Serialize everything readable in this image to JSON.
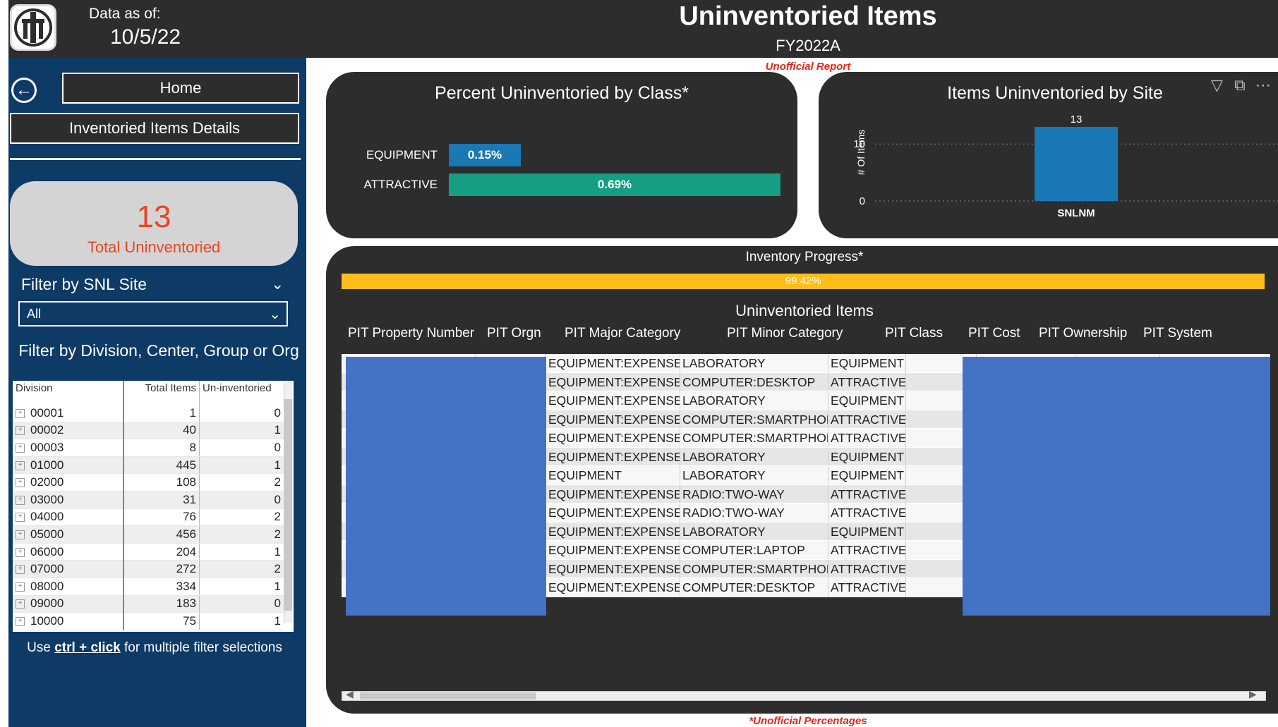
{
  "header": {
    "as_of_label": "Data as of:",
    "as_of_date": "10/5/22",
    "title": "Uninventoried Items",
    "subtitle": "FY2022A",
    "unofficial_report": "Unofficial Report"
  },
  "sidebar": {
    "back_icon": "back-arrow-icon",
    "home_label": "Home",
    "details_label": "Inventoried Items Details",
    "kpi_value": "13",
    "kpi_label": "Total Uninventoried",
    "site_filter_label": "Filter by SNL Site",
    "site_filter_value": "All",
    "division_filter_label": "Filter by Division, Center, Group or Org",
    "division_table": {
      "headers": [
        "Division",
        "Total Items",
        "Un-inventoried"
      ],
      "rows": [
        {
          "division": "00001",
          "total": "1",
          "uninv": "0"
        },
        {
          "division": "00002",
          "total": "40",
          "uninv": "1"
        },
        {
          "division": "00003",
          "total": "8",
          "uninv": "0"
        },
        {
          "division": "01000",
          "total": "445",
          "uninv": "1"
        },
        {
          "division": "02000",
          "total": "108",
          "uninv": "2"
        },
        {
          "division": "03000",
          "total": "31",
          "uninv": "0"
        },
        {
          "division": "04000",
          "total": "76",
          "uninv": "2"
        },
        {
          "division": "05000",
          "total": "456",
          "uninv": "2"
        },
        {
          "division": "06000",
          "total": "204",
          "uninv": "1"
        },
        {
          "division": "07000",
          "total": "272",
          "uninv": "2"
        },
        {
          "division": "08000",
          "total": "334",
          "uninv": "1"
        },
        {
          "division": "09000",
          "total": "183",
          "uninv": "0"
        },
        {
          "division": "10000",
          "total": "75",
          "uninv": "1"
        }
      ]
    },
    "hint_prefix": "Use ",
    "hint_key": "ctrl + click",
    "hint_suffix": " for multiple filter selections"
  },
  "class_card": {
    "title": "Percent Uninventoried by Class*",
    "bars": [
      {
        "label": "EQUIPMENT",
        "value_label": "0.15%",
        "value": 0.15,
        "color": "#1a78b4"
      },
      {
        "label": "ATTRACTIVE",
        "value_label": "0.69%",
        "value": 0.69,
        "color": "#159e82"
      }
    ],
    "max_value": 0.69
  },
  "site_card": {
    "title": "Items Uninventoried by Site",
    "icons": [
      "filter-icon",
      "focus-mode-icon",
      "more-options-icon"
    ],
    "chart_data": {
      "type": "bar",
      "categories": [
        "SNLNM"
      ],
      "values": [
        13
      ],
      "ylabel": "# Of Items",
      "yticks": [
        "0",
        "10"
      ],
      "ylim": [
        0,
        13
      ],
      "grid": true,
      "color": "#1a78b4"
    }
  },
  "progress": {
    "title": "Inventory Progress*",
    "value_label": "99.42%",
    "value": 99.42,
    "color": "#ffbe1a"
  },
  "items_table": {
    "title": "Uninventoried Items",
    "headers": [
      "PIT Property Number",
      "PIT Orgn",
      "PIT Major Category",
      "PIT Minor Category",
      "PIT Class",
      "PIT Cost",
      "PIT Ownership",
      "PIT System"
    ],
    "rows": [
      {
        "major": "EQUIPMENT:EXPENSED",
        "minor": "LABORATORY",
        "class": "EQUIPMENT"
      },
      {
        "major": "EQUIPMENT:EXPENSED",
        "minor": "COMPUTER:DESKTOP",
        "class": "ATTRACTIVE"
      },
      {
        "major": "EQUIPMENT:EXPENSED",
        "minor": "LABORATORY",
        "class": "EQUIPMENT"
      },
      {
        "major": "EQUIPMENT:EXPENSED",
        "minor": "COMPUTER:SMARTPHONE",
        "class": "ATTRACTIVE"
      },
      {
        "major": "EQUIPMENT:EXPENSED",
        "minor": "COMPUTER:SMARTPHONE",
        "class": "ATTRACTIVE"
      },
      {
        "major": "EQUIPMENT:EXPENSED",
        "minor": "LABORATORY",
        "class": "EQUIPMENT"
      },
      {
        "major": "EQUIPMENT",
        "minor": "LABORATORY",
        "class": "EQUIPMENT"
      },
      {
        "major": "EQUIPMENT:EXPENSED",
        "minor": "RADIO:TWO-WAY",
        "class": "ATTRACTIVE"
      },
      {
        "major": "EQUIPMENT:EXPENSED",
        "minor": "RADIO:TWO-WAY",
        "class": "ATTRACTIVE"
      },
      {
        "major": "EQUIPMENT:EXPENSED",
        "minor": "LABORATORY",
        "class": "EQUIPMENT"
      },
      {
        "major": "EQUIPMENT:EXPENSED",
        "minor": "COMPUTER:LAPTOP",
        "class": "ATTRACTIVE"
      },
      {
        "major": "EQUIPMENT:EXPENSED",
        "minor": "COMPUTER:SMARTPHONE",
        "class": "ATTRACTIVE"
      },
      {
        "major": "EQUIPMENT:EXPENSED",
        "minor": "COMPUTER:DESKTOP",
        "class": "ATTRACTIVE"
      }
    ]
  },
  "footer": {
    "unofficial_percentages": "*Unofficial Percentages"
  },
  "colors": {
    "header_bg": "#2d2d2d",
    "sidebar_bg": "#0e3a66",
    "accent_red": "#e0261b",
    "kpi_orange": "#ea4522",
    "redaction_blue": "#4472c4"
  }
}
